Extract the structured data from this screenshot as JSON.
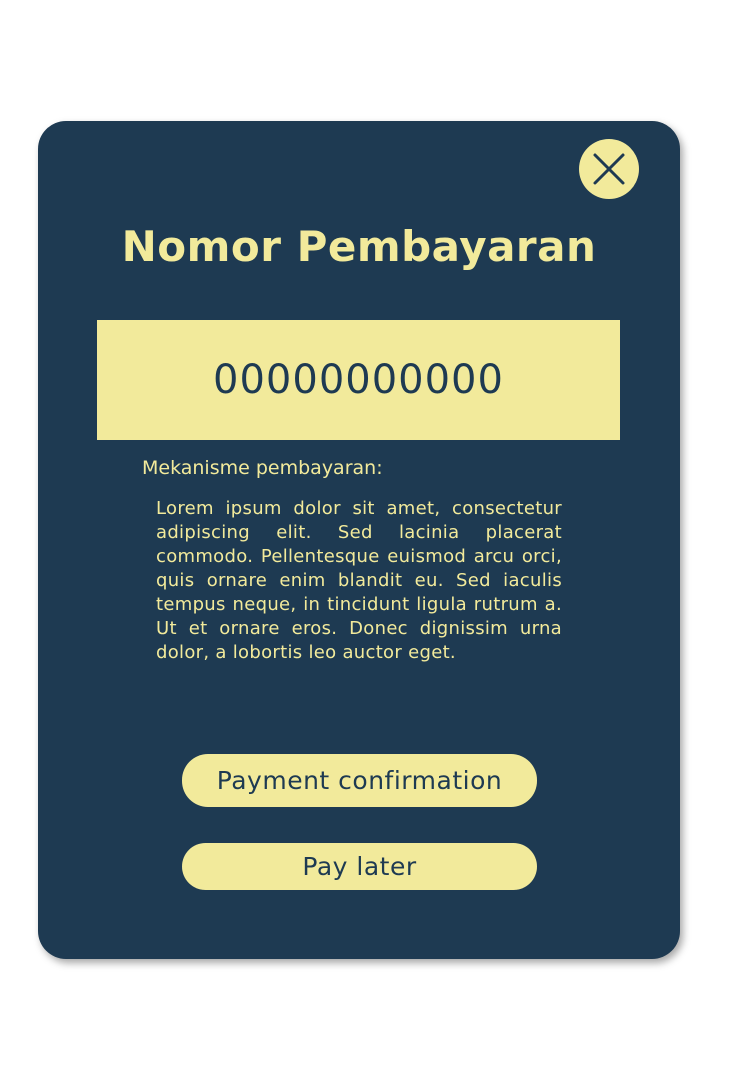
{
  "modal": {
    "title": "Nomor Pembayaran",
    "payment_number": "00000000000",
    "mechanism_label": "Mekanisme pembayaran:",
    "mechanism_text": "Lorem ipsum dolor sit amet, consectetur adipiscing elit. Sed lacinia placerat commodo. Pellentesque euismod arcu orci, quis ornare enim blandit eu. Sed iaculis tempus neque, in tincidunt ligula rutrum a. Ut et ornare eros. Donec dignissim urna dolor, a lobortis leo auctor eget.",
    "close_icon": "close-icon",
    "buttons": {
      "confirm_label": "Payment confirmation",
      "later_label": "Pay later"
    }
  },
  "colors": {
    "modal_background": "#1e3a52",
    "accent": "#f2ea9b",
    "page_background": "#ffffff"
  }
}
